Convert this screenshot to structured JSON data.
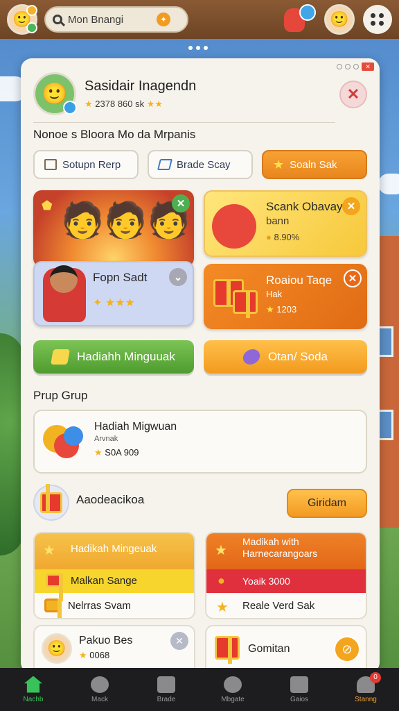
{
  "search": {
    "value": "Mon Bnangi"
  },
  "profile": {
    "name": "Sasidair Inagendn",
    "stats": "2378 860 sk"
  },
  "sections": {
    "top_title": "Nonoe s Bloora Mo da Mrpanis",
    "group_title": "Prup Grup"
  },
  "filters": [
    {
      "label": "Sotupn Rerp"
    },
    {
      "label": "Brade Scay"
    },
    {
      "label": "Soaln Sak"
    }
  ],
  "cards": {
    "hero_lower": {
      "title": "Fopn Sadt"
    },
    "yellow": {
      "title": "Scank Obavay",
      "subtitle": "bann",
      "value": "8.90%"
    },
    "orange": {
      "title": "Roaiou Taqe",
      "subtitle": "Hak",
      "value": "1203"
    }
  },
  "buttons": {
    "green": "Hadiahh Minguuak",
    "orange": "Otan/ Soda"
  },
  "list_item": {
    "title": "Hadiah Migwuan",
    "subtitle": "Arvnak",
    "stats": "S0A  909"
  },
  "announce": {
    "title": "Aaodeacikoa",
    "button": "Giridam"
  },
  "reward_left": {
    "header": "Hadikah Mingeuak",
    "mid": "Malkan Sange",
    "bottom": "Nelrras Svam"
  },
  "reward_right": {
    "header": "Madikah with Harnecarangoars",
    "mid": "Yoaik 3000",
    "bottom": "Reale Verd Sak"
  },
  "friends": {
    "left": {
      "name": "Pakuo Bes",
      "stats": "0068"
    },
    "right": {
      "name": "Gomitan"
    }
  },
  "nav": [
    {
      "label": "Nachb",
      "icon": "home-icon",
      "active": true
    },
    {
      "label": "Mack",
      "icon": "search-icon"
    },
    {
      "label": "Brade",
      "icon": "shop-icon"
    },
    {
      "label": "Mbgate",
      "icon": "search-circle-icon"
    },
    {
      "label": "Gaios",
      "icon": "list-icon"
    },
    {
      "label": "Stanng",
      "icon": "profile-icon",
      "badge": "0"
    }
  ],
  "colors": {
    "accent_orange": "#f29a1e",
    "accent_green": "#4e9b2f",
    "nav_active": "#39c25a"
  }
}
